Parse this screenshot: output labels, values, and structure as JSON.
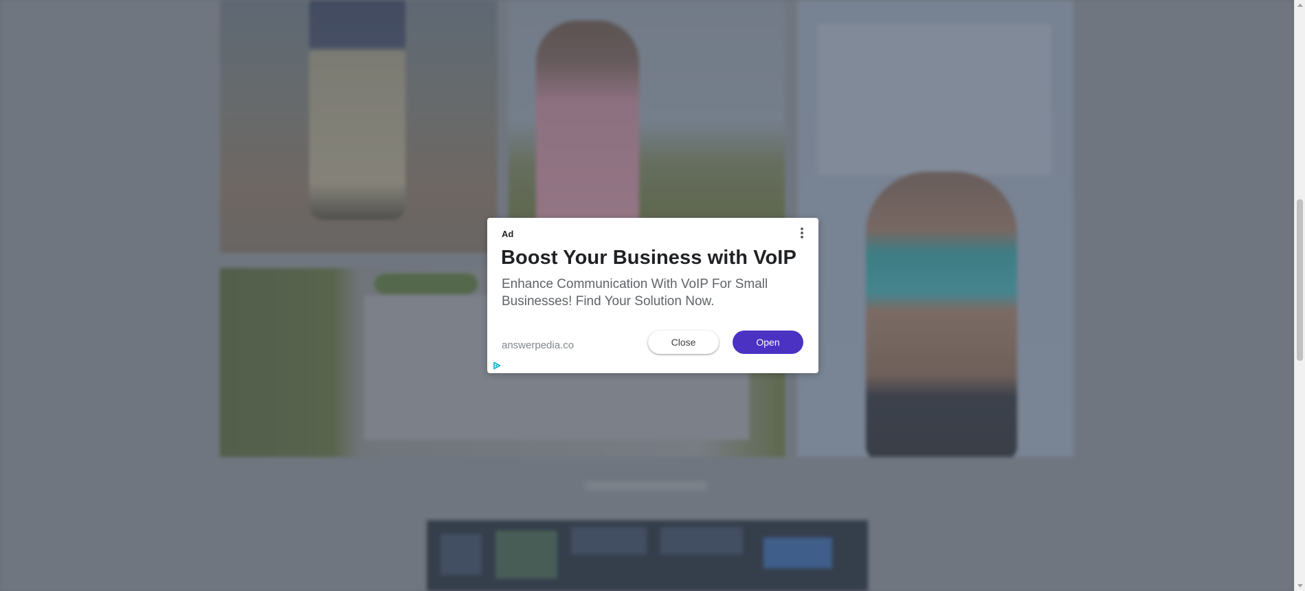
{
  "ad": {
    "label": "Ad",
    "headline": "Boost Your Business with VoIP",
    "body": "Enhance Communication With VoIP For Small Businesses! Find Your Solution Now.",
    "domain": "answerpedia.co",
    "close_label": "Close",
    "open_label": "Open",
    "menu_icon": "more-vert-icon",
    "adchoices_icon": "adchoices-icon"
  },
  "colors": {
    "open_button": "#4b32c3",
    "adchoices": "#00aecd",
    "overlay": "#5f646c"
  }
}
